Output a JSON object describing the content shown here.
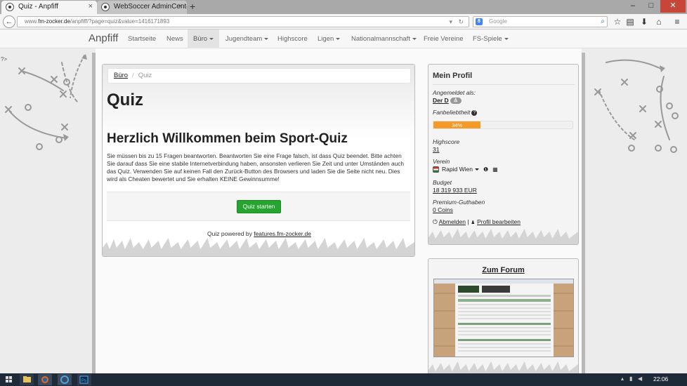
{
  "browser": {
    "tabs": [
      {
        "label": "Quiz - Anpfiff",
        "active": true
      },
      {
        "label": "WebSoccer AdminCenter",
        "active": false
      }
    ],
    "new_tab": "+",
    "url_prefix": "www.",
    "url_domain": "fm-zocker.de",
    "url_path": "/anpfiff/?page=quiz&value=1416171893",
    "search_placeholder": "Google",
    "search_engine_badge": "8",
    "window_controls": {
      "minimize": "–",
      "maximize": "□",
      "close": "✕"
    }
  },
  "site": {
    "brand": "Anpfiff",
    "nav": [
      {
        "label": "Startseite",
        "dropdown": false,
        "active": false
      },
      {
        "label": "News",
        "dropdown": false,
        "active": false
      },
      {
        "label": "Büro",
        "dropdown": true,
        "active": true
      },
      {
        "label": "Jugendteam",
        "dropdown": true,
        "active": false
      },
      {
        "label": "Highscore",
        "dropdown": false,
        "active": false
      },
      {
        "label": "Ligen",
        "dropdown": true,
        "active": false
      },
      {
        "label": "Nationalmannschaft",
        "dropdown": true,
        "active": false
      },
      {
        "label": "Freie Vereine",
        "dropdown": false,
        "active": false
      },
      {
        "label": "FS-Spiele",
        "dropdown": true,
        "active": false
      }
    ],
    "edge_marker": "?>"
  },
  "breadcrumb": {
    "parent": "Büro",
    "separator": "/",
    "current": "Quiz"
  },
  "main": {
    "title": "Quiz",
    "welcome": "Herzlich Willkommen beim Sport-Quiz",
    "intro": "Sie müssen bis zu 15 Fragen beantworten. Beantworten Sie eine Frage falsch, ist dass Quiz beendet. Bitte achten Sie darauf dass Sie eine stabile Internetverbindung haben, ansonsten verlieren Sie Zeit und unter Umständen auch das Quiz. Verwenden Sie auf keinen Fall den Zurück-Button des Browsers und laden Sie die Seite nicht neu. Dies wird als Cheaten bewertet und Sie erhalten KEINE Gewinnsumme!",
    "start_button": "Quiz starten",
    "powered_prefix": "Quiz powered by ",
    "powered_link": "features.fm-zocker.de"
  },
  "profile": {
    "title": "Mein Profil",
    "logged_in_label": "Angemeldet als:",
    "username": "Der D",
    "fan_label": "Fanbeliebtheit",
    "fan_percent": 34,
    "fan_text": "34%",
    "highscore_label": "Highscore",
    "highscore_value": "31",
    "verein_label": "Verein",
    "verein_value": "Rapid Wien",
    "budget_label": "Budget",
    "budget_value": "18 319 933 EUR",
    "premium_label": "Premium-Guthaben",
    "premium_value": "0 Coins",
    "logout": "Abmelden",
    "link_separator": "|",
    "edit_profile": "Profil bearbeiten"
  },
  "forum": {
    "title": "Zum Forum"
  },
  "taskbar": {
    "clock": "22:06"
  },
  "colors": {
    "accent_green": "#25a42f",
    "progress_orange": "#f49a28",
    "taskbar": "#1f2a38"
  }
}
